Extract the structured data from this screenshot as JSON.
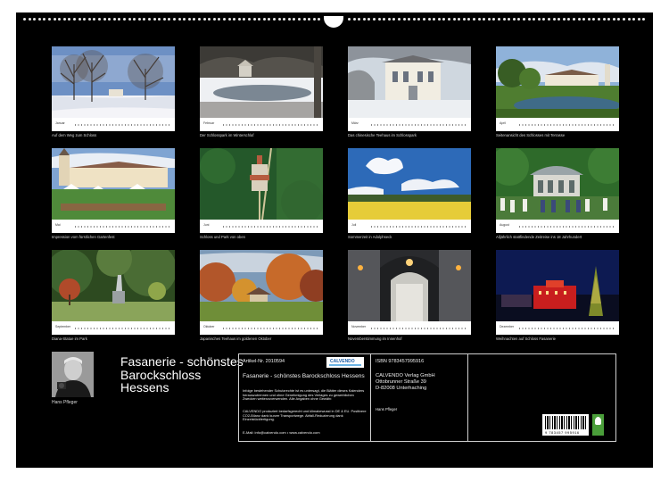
{
  "months": [
    {
      "name": "Januar",
      "caption": "Auf dem Weg zum Schloss"
    },
    {
      "name": "Februar",
      "caption": "Der Schlosspark im Winterschlaf"
    },
    {
      "name": "März",
      "caption": "Das chinesische Teehaus im Schlosspark"
    },
    {
      "name": "April",
      "caption": "Seitenansicht des Schlosses mit Terrasse"
    },
    {
      "name": "Mai",
      "caption": "Impression vom fürstlichen Gartenfest"
    },
    {
      "name": "Juni",
      "caption": "Schloss und Park von oben"
    },
    {
      "name": "Juli",
      "caption": "Sommerzeit in Adolphseck"
    },
    {
      "name": "August",
      "caption": "Alljährlich stattfindende Zeitreise ins 18 Jahrhundert"
    },
    {
      "name": "September",
      "caption": "Diana-Statue im Park"
    },
    {
      "name": "Oktober",
      "caption": "Japanisches Teehaus im goldenen Oktober"
    },
    {
      "name": "November",
      "caption": "Novemberstimmung im Innenhof"
    },
    {
      "name": "Dezember",
      "caption": "Weihnachten auf Schloss Fasanerie"
    }
  ],
  "author": "Hans Pfleger",
  "title": "Fasanerie - schönstes Barockschloss Hessens",
  "info": {
    "article": "Artikel-Nr. 2010594",
    "isbn": "ISBN 9783457995916",
    "brand": "CALVENDO",
    "book_title": "Fasanerie - schönstes Barockschloss Hessens",
    "copyright1": "Infolge bestehender Schutzrechte ist es untersagt, die Blätter dieses Kalenders herauszutrennen und ohne Genehmigung des Verlages zu gewerblichen Zwecken weiterzuverwenden. Alle Angaben ohne Gewähr.",
    "copyright2": "CALVENDO produziert bedarfsgerecht und klimabewusst in DE & EU. Positivere CO2-Bilanz dank kurzer Transportwege. Abfall-Reduzierung dank Einzelstückfertigung.",
    "contact": "E-Mail: info@calvendo.com • www.calvendo.com",
    "publisher_lines": [
      "CALVENDO Verlag GmbH",
      "Ottobrunner Straße 39",
      "D-82008 Unterhaching"
    ],
    "photographer": "Hans Pfleger",
    "barcode_number": "9 783457 995916"
  }
}
